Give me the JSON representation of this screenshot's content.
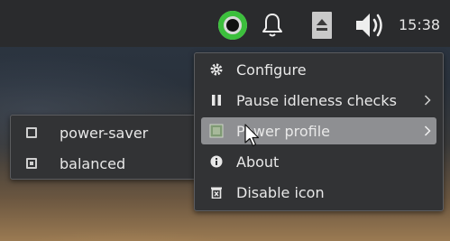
{
  "panel": {
    "clock": "15:38",
    "tray": {
      "disk_icon": "disk-usage-ring-icon",
      "notifications_icon": "bell-icon",
      "media_icon": "eject-icon",
      "volume_icon": "speaker-volume-icon"
    }
  },
  "context_menu": {
    "items": [
      {
        "label": "Configure",
        "icon": "gear-icon"
      },
      {
        "label": "Pause idleness checks",
        "icon": "pause-icon",
        "has_submenu": true
      },
      {
        "label": "Power profile",
        "icon": "power-profile-icon",
        "has_submenu": true,
        "highlighted": true
      },
      {
        "label": "About",
        "icon": "info-icon"
      },
      {
        "label": "Disable icon",
        "icon": "trash-icon"
      }
    ]
  },
  "power_profile_submenu": {
    "options": [
      {
        "label": "power-saver",
        "checked": false
      },
      {
        "label": "balanced",
        "checked": true
      }
    ]
  },
  "colors": {
    "panel_bg": "#2a2b2d",
    "menu_bg": "#323335",
    "highlight": "#8e8f92",
    "disk_ring_green": "#3cbf3c"
  }
}
